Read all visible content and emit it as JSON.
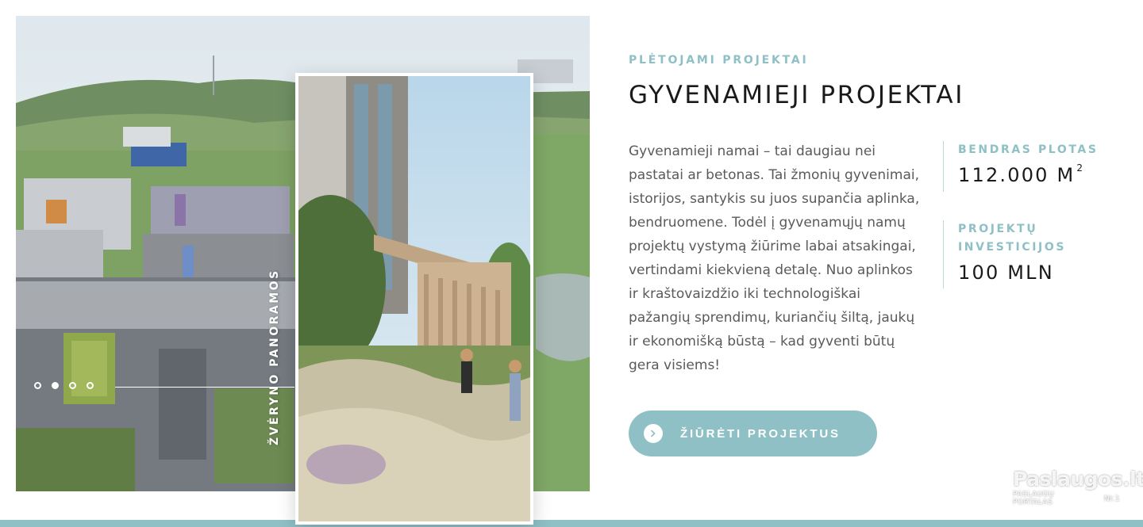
{
  "hero": {
    "vertical_label": "ŽVĖRYNO PANORAMOS",
    "slider": {
      "count": 4,
      "active_index": 1
    }
  },
  "section": {
    "kicker": "PLĖTOJAMI PROJEKTAI",
    "title": "GYVENAMIEJI PROJEKTAI",
    "description": "Gyvenamieji namai – tai daugiau nei pastatai ar betonas. Tai žmonių gyvenimai, istorijos, santykis su juos supančia aplinka, bendruomene. Todėl į gyvenamųjų namų projektų vystymą žiūrime labai atsakingai, vertindami kiekvieną detalę. Nuo aplinkos ir kraštovaizdžio iki technologiškai pažangių sprendimų, kuriančių šiltą, jaukų ir ekonomišką būstą – kad gyventi būtų gera visiems!"
  },
  "stats": {
    "area_label": "BENDRAS PLOTAS",
    "area_value": "112.000 M",
    "area_unit_sup": "2",
    "investment_label": "PROJEKTŲ INVESTICIJOS",
    "investment_value": "100 MLN"
  },
  "cta": {
    "label": "ŽIŪRĖTI PROJEKTUS",
    "icon": "chevron-right-icon"
  },
  "watermark": {
    "logo": "Paslaugos.lt",
    "tagline": "PASLAUGŲ PORTALAS",
    "badge": "Nr.1"
  },
  "colors": {
    "accent": "#8ec0c5",
    "title": "#1a1a1a",
    "body_text": "#5a5a5a"
  }
}
